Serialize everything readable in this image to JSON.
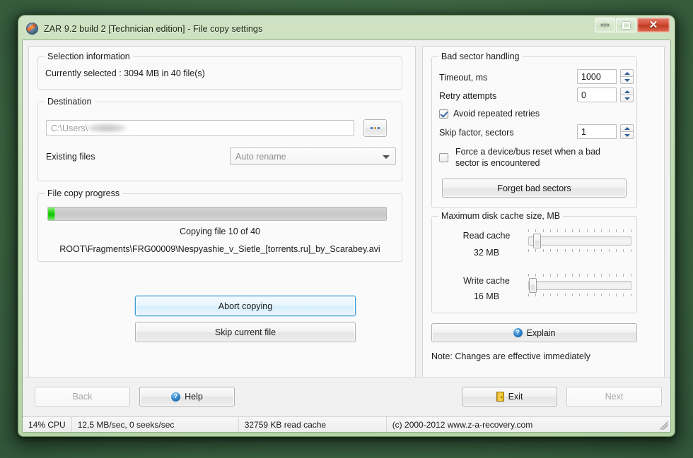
{
  "window": {
    "title": "ZAR 9.2 build 2 [Technician edition] - File copy settings",
    "app_icon": "disc-icon",
    "minimize_label": "–",
    "maximize_label": "□",
    "close_label": "✕"
  },
  "selection": {
    "group_title": "Selection information",
    "text": "Currently selected : 3094 MB in 40 file(s)"
  },
  "destination": {
    "group_title": "Destination",
    "path_value": "C:\\Users\\",
    "browse_label": "...",
    "existing_files_label": "Existing files",
    "existing_files_value": "Auto rename"
  },
  "progress": {
    "group_title": "File copy progress",
    "percent": 2,
    "status": "Copying file 10 of 40",
    "current_file": "ROOT\\Fragments\\FRG00009\\Nespyashie_v_Sietle_[torrents.ru]_by_Scarabey.avi"
  },
  "actions": {
    "abort_label": "Abort copying",
    "skip_label": "Skip current file"
  },
  "bad_sector": {
    "group_title": "Bad sector handling",
    "timeout_label": "Timeout, ms",
    "timeout_value": "1000",
    "retry_label": "Retry attempts",
    "retry_value": "0",
    "avoid_label": "Avoid repeated retries",
    "avoid_checked": true,
    "skip_factor_label": "Skip factor, sectors",
    "skip_factor_value": "1",
    "force_reset_label": "Force a device/bus reset when a bad sector is encountered",
    "force_reset_checked": false,
    "forget_label": "Forget bad sectors"
  },
  "cache": {
    "group_title": "Maximum disk cache size, MB",
    "read_label": "Read cache",
    "read_value": "32 MB",
    "read_pos_pct": 5,
    "write_label": "Write cache",
    "write_value": "16 MB",
    "write_pos_pct": 1,
    "tick_count": 15
  },
  "explain": {
    "label": "Explain",
    "icon": "help-circle-icon",
    "note": "Note: Changes are effective immediately"
  },
  "footer": {
    "back_label": "Back",
    "back_enabled": false,
    "help_label": "Help",
    "exit_label": "Exit",
    "next_label": "Next",
    "next_enabled": false
  },
  "statusbar": {
    "cpu": "14% CPU",
    "throughput": "12,5 MB/sec, 0 seeks/sec",
    "read_cache": "32759 KB read cache",
    "copyright": "(c) 2000-2012 www.z-a-recovery.com"
  },
  "colors": {
    "frame": "#bcd9ae",
    "progress_fill": "#25d213",
    "accent_default_button": "#3c9bd4",
    "close_button": "#cf4a32"
  }
}
